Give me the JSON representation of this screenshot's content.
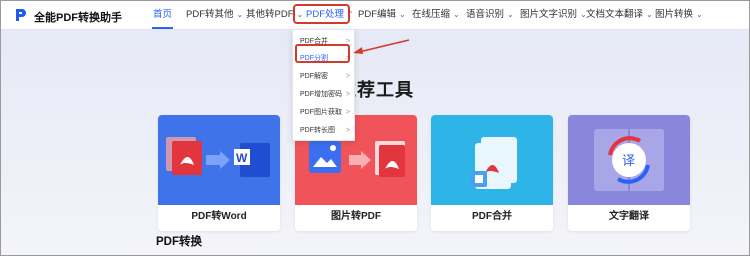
{
  "brand": {
    "name": "全能PDF转换助手"
  },
  "nav": {
    "items": [
      {
        "label": "首页",
        "has_menu": false
      },
      {
        "label": "PDF转其他",
        "has_menu": true
      },
      {
        "label": "其他转PDF",
        "has_menu": true
      },
      {
        "label": "PDF处理",
        "has_menu": true
      },
      {
        "label": "PDF编辑",
        "has_menu": true
      },
      {
        "label": "在线压缩",
        "has_menu": true
      },
      {
        "label": "语音识别",
        "has_menu": true
      },
      {
        "label": "图片文字识别",
        "has_menu": true
      },
      {
        "label": "文档文本翻译",
        "has_menu": true
      },
      {
        "label": "图片转换",
        "has_menu": true
      }
    ],
    "chevron": "⌄"
  },
  "dropdown": {
    "items": [
      "PDF合并",
      "PDF分割",
      "PDF解密",
      "PDF增加密码",
      "PDF图片获取",
      "PDF转长图"
    ],
    "arrow": ">"
  },
  "hero": {
    "title": "推荐工具"
  },
  "cards": [
    {
      "label": "PDF转Word",
      "icon": "pdf-to-word-icon"
    },
    {
      "label": "图片转PDF",
      "icon": "image-to-pdf-icon"
    },
    {
      "label": "PDF合并",
      "icon": "pdf-merge-icon"
    },
    {
      "label": "文字翻译",
      "icon": "translate-icon"
    }
  ],
  "section": {
    "title": "PDF转换"
  },
  "colors": {
    "accent": "#2a62f5",
    "annotation_red": "#d43a2a",
    "card1": "#3f73ea",
    "card2": "#f0545a",
    "card3": "#2fb4e8",
    "card4": "#8a86dc"
  }
}
